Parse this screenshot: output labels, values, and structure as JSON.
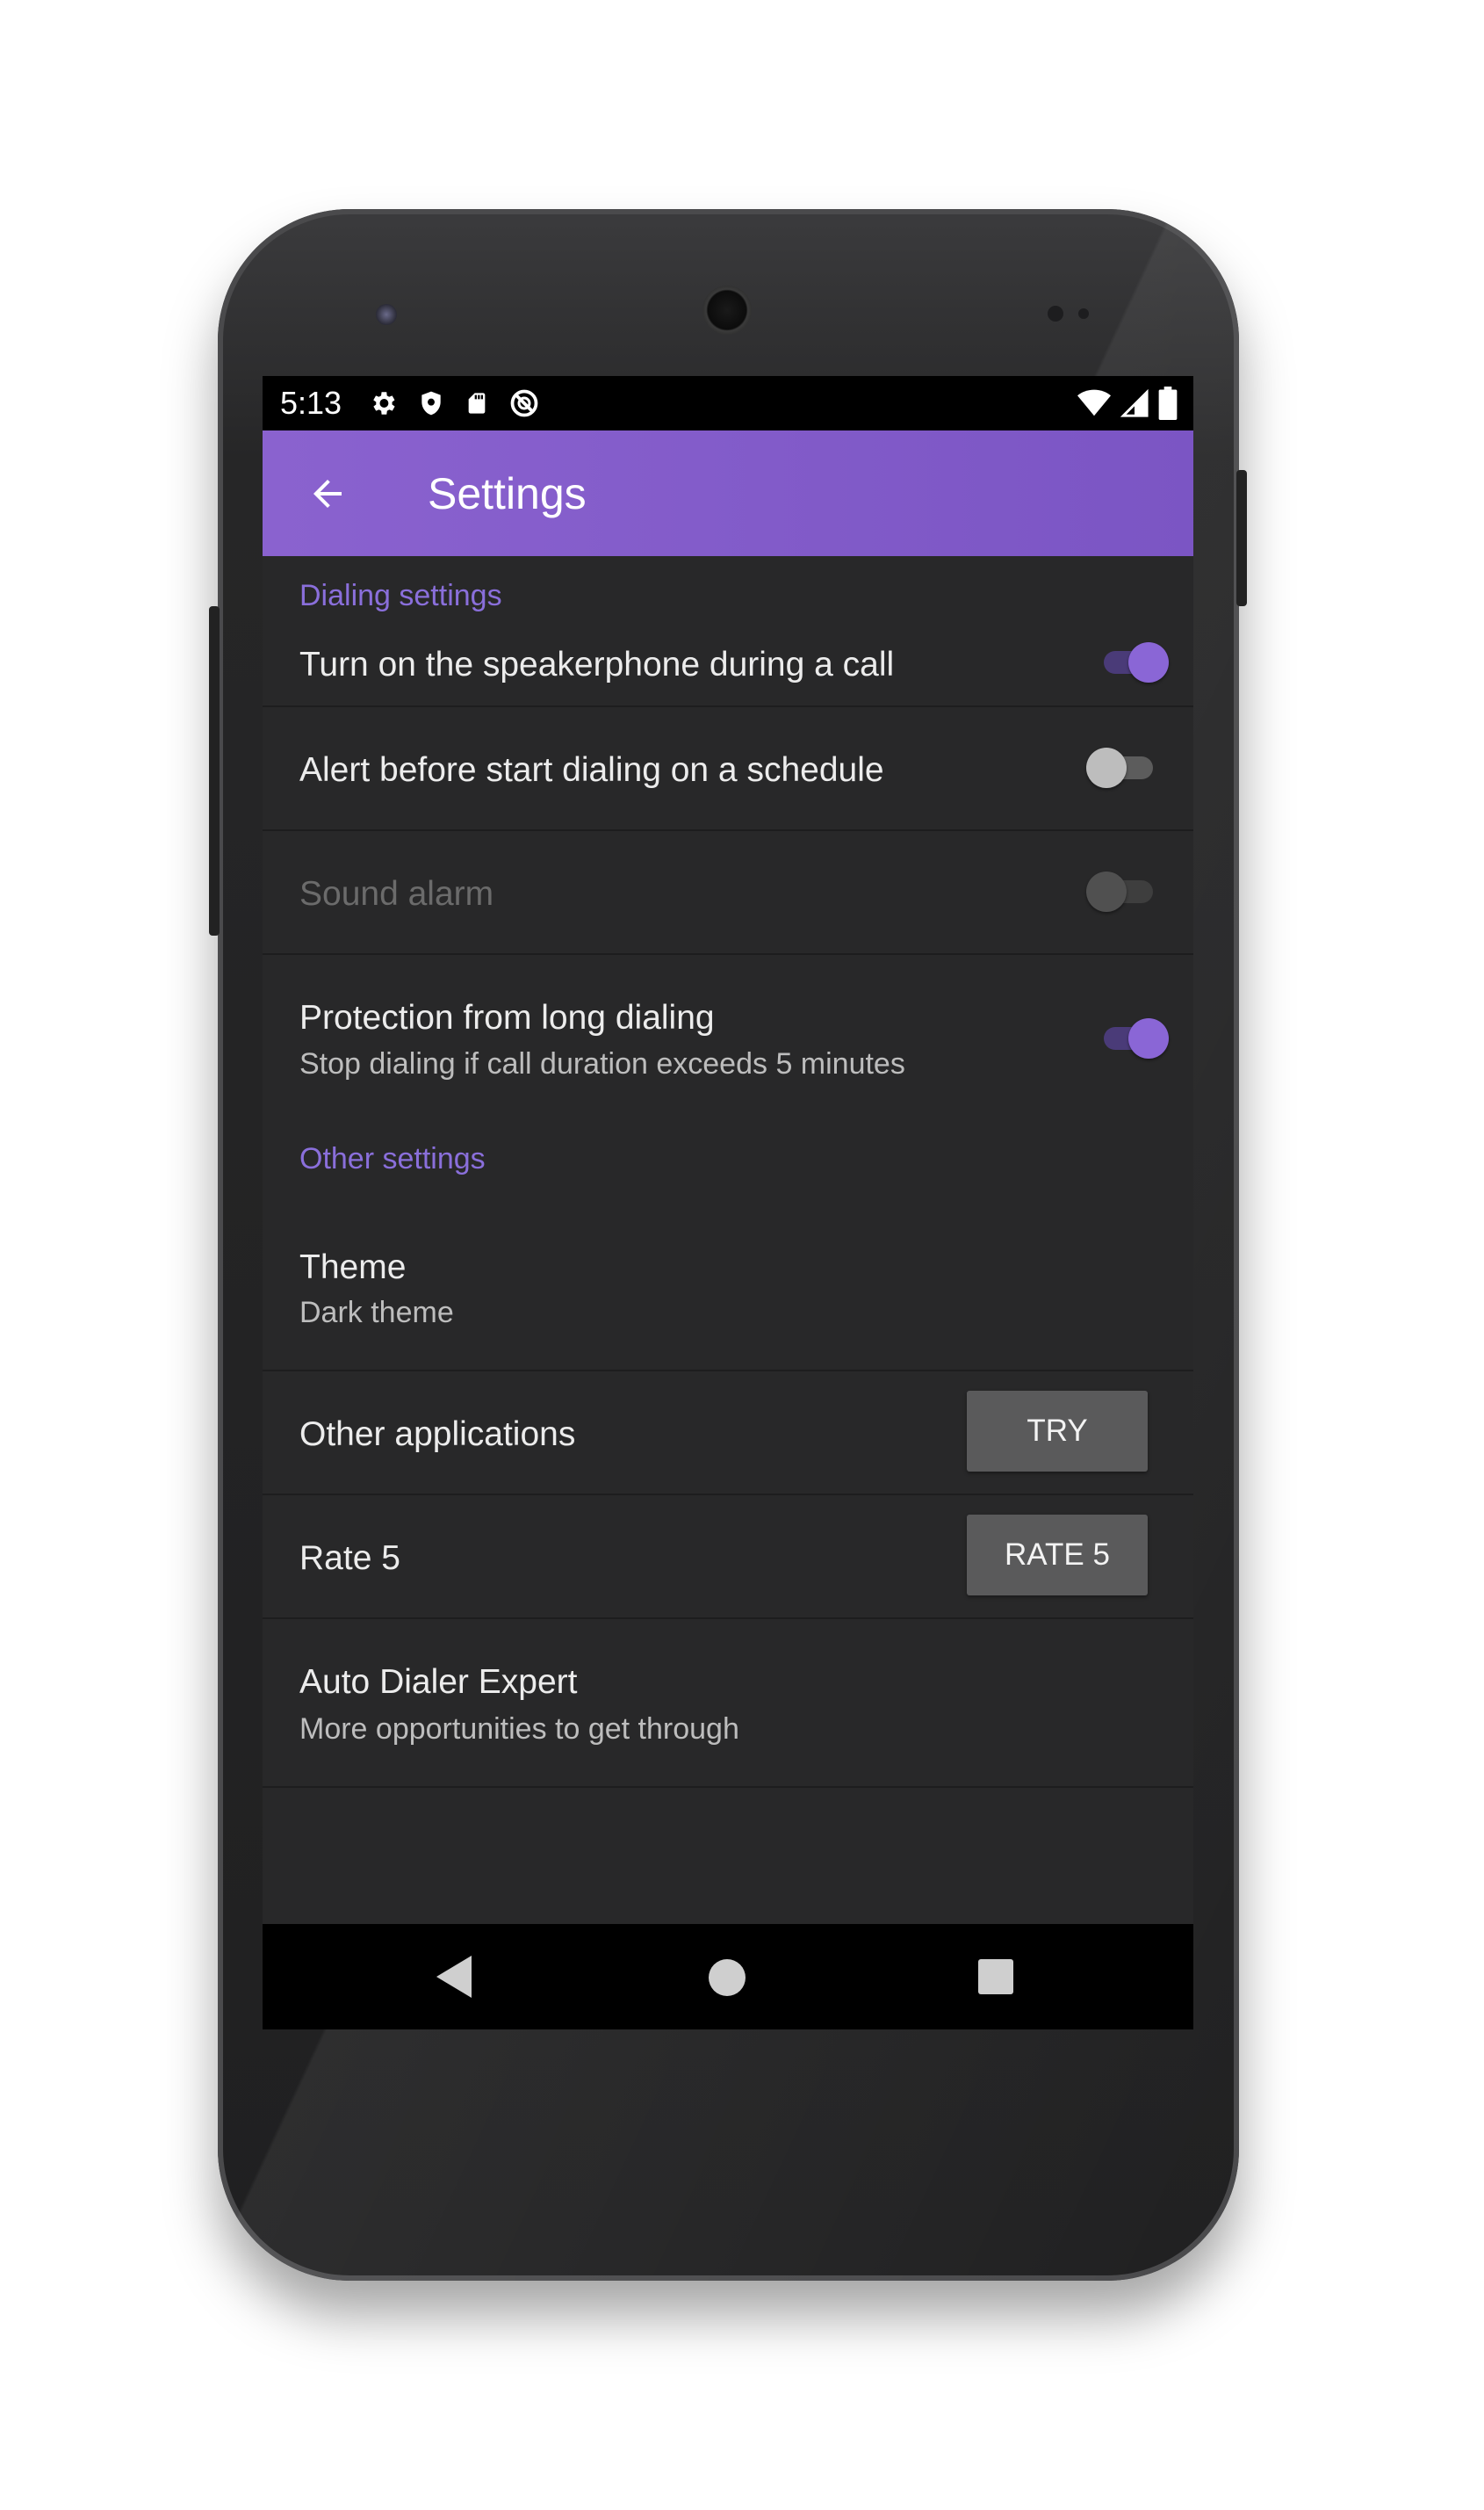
{
  "status_bar": {
    "time": "5:13",
    "left_icons": [
      "gear-icon",
      "shield-icon",
      "sd-card-icon",
      "sync-off-icon"
    ],
    "right_icons": [
      "wifi-icon",
      "signal-icon",
      "battery-icon"
    ]
  },
  "toolbar": {
    "title": "Settings",
    "back_icon": "arrow-left-icon"
  },
  "sections": {
    "dialing": {
      "header": "Dialing settings",
      "speakerphone": {
        "title": "Turn on the speakerphone during a call",
        "enabled": true
      },
      "alert": {
        "title": "Alert before start dialing on a schedule",
        "enabled": false
      },
      "sound_alarm": {
        "title": "Sound alarm",
        "enabled": false,
        "disabled": true
      },
      "protection": {
        "title": "Protection from long dialing",
        "subtitle": "Stop dialing if call duration exceeds 5 minutes",
        "enabled": true
      }
    },
    "other": {
      "header": "Other settings",
      "theme": {
        "title": "Theme",
        "subtitle": "Dark theme"
      },
      "other_apps": {
        "title": "Other applications",
        "button": "TRY"
      },
      "rate": {
        "title": "Rate 5",
        "button": "RATE 5"
      },
      "auto_dialer": {
        "title": "Auto Dialer Expert",
        "subtitle": "More opportunities to get through"
      }
    }
  },
  "nav_bar": {
    "icons": [
      "back-triangle-icon",
      "home-circle-icon",
      "recents-square-icon"
    ]
  },
  "colors": {
    "accent": "#7b55c4",
    "section_header": "#8a6fdb",
    "background": "#282829"
  }
}
